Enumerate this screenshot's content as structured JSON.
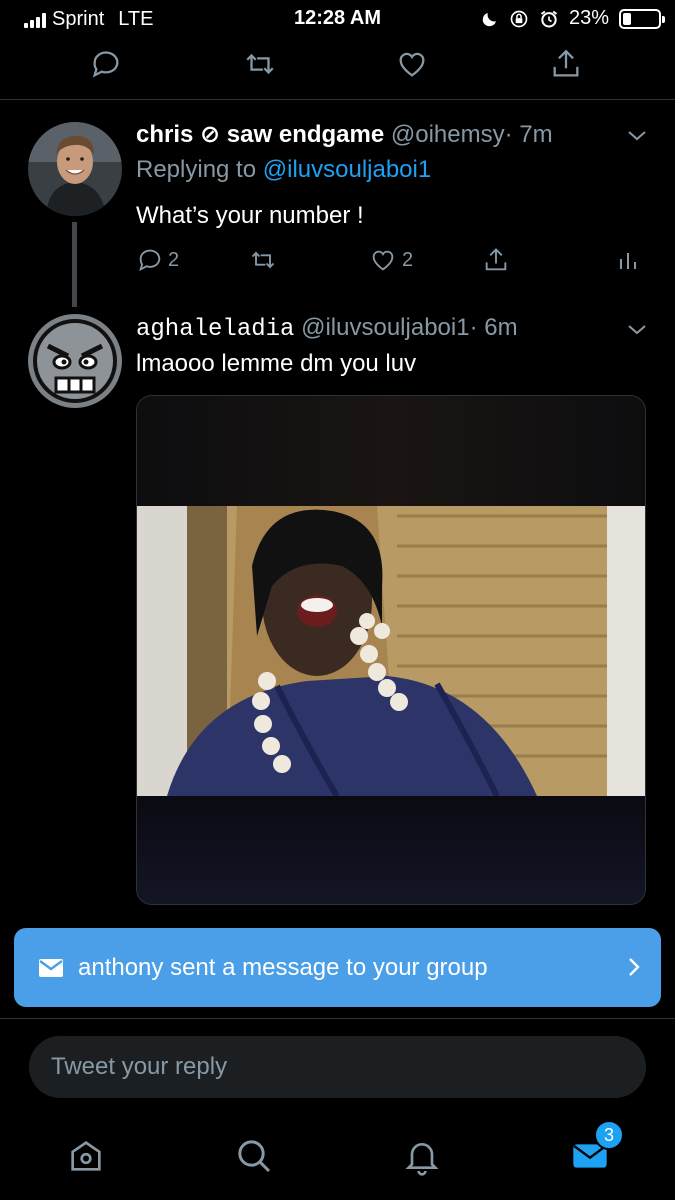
{
  "status_bar": {
    "carrier": "Sprint",
    "network": "LTE",
    "time": "12:28 AM",
    "battery": "23%",
    "battery_level": 0.23,
    "icons": [
      "moon-icon",
      "orientation-lock-icon",
      "alarm-icon"
    ]
  },
  "top_actions": [
    "reply-icon",
    "retweet-icon",
    "like-icon",
    "share-icon"
  ],
  "tweets": [
    {
      "name": "chris ⊘ saw endgame",
      "handle": "@oihemsy",
      "time": "· 7m",
      "reply_prefix": "Replying to ",
      "reply_to": "@iluvsouljaboi1",
      "text": "What’s your number !",
      "reply_count": "2",
      "retweet_count": "",
      "like_count": "2"
    },
    {
      "name": "aghaleladia",
      "handle": "@iluvsouljaboi1",
      "time": "· 6m",
      "text": "lmaooo lemme dm you luv"
    }
  ],
  "notification": {
    "text": "anthony sent a message to your group"
  },
  "reply_box": {
    "placeholder": "Tweet your reply"
  },
  "tabbar": {
    "messages_badge": "3"
  },
  "colors": {
    "background": "#000000",
    "accent": "#1da1f2",
    "muted": "#8899a6",
    "banner": "#4b9fe8"
  }
}
